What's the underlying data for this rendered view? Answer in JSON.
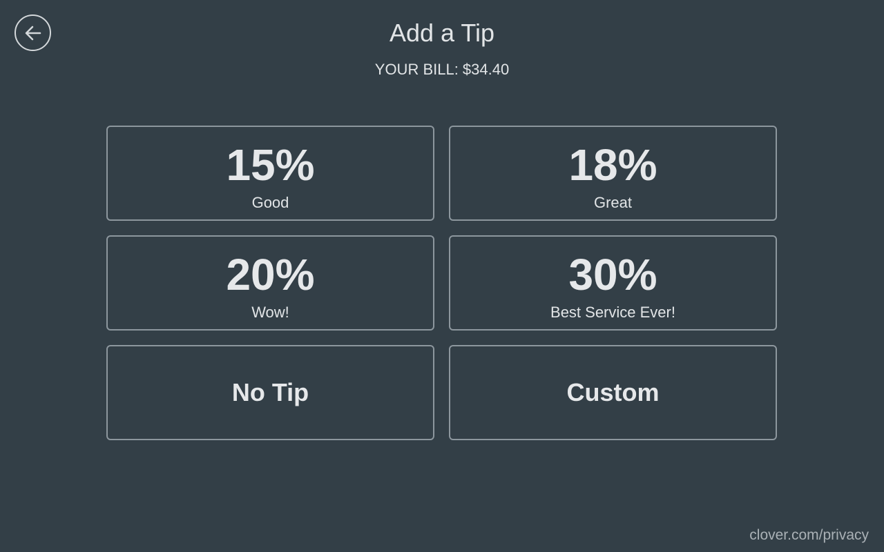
{
  "header": {
    "title": "Add a Tip",
    "bill": "YOUR BILL: $34.40"
  },
  "tips": [
    {
      "percent": "15%",
      "label": "Good"
    },
    {
      "percent": "18%",
      "label": "Great"
    },
    {
      "percent": "20%",
      "label": "Wow!"
    },
    {
      "percent": "30%",
      "label": "Best Service Ever!"
    }
  ],
  "actions": {
    "no_tip": "No Tip",
    "custom": "Custom"
  },
  "footer": {
    "privacy_link": "clover.com/privacy"
  },
  "icons": {
    "back": "arrow-left-icon"
  },
  "colors": {
    "background": "#333f47",
    "border": "#8d979e",
    "text": "#e6e8ea",
    "muted": "#aab1b6"
  }
}
